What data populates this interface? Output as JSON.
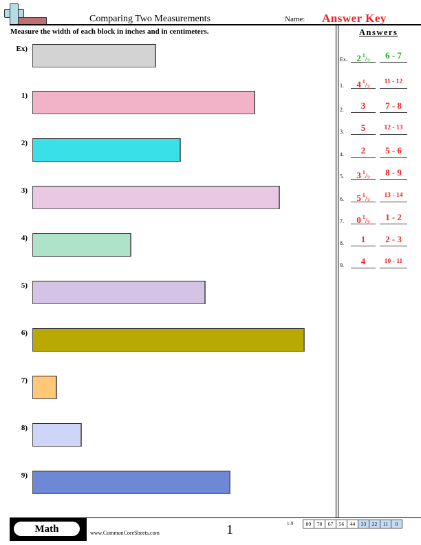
{
  "header": {
    "logo": "plus-ruler-logo",
    "title": "Comparing Two Measurements",
    "name_label": "Name:",
    "name_value": "Answer Key"
  },
  "instructions": "Measure the width of each block in inches and in centimeters.",
  "colors": {
    "answer_red": "#ee2222",
    "example_green": "#22aa22"
  },
  "problems": [
    {
      "label": "Ex)",
      "color": "#d3d3d3",
      "width_in": "2 1/2"
    },
    {
      "label": "1)",
      "color": "#f2b3c9",
      "width_in": "4 1/2"
    },
    {
      "label": "2)",
      "color": "#3ae0e8",
      "width_in": "3"
    },
    {
      "label": "3)",
      "color": "#e9c8e4",
      "width_in": "5"
    },
    {
      "label": "4)",
      "color": "#aee3c9",
      "width_in": "2"
    },
    {
      "label": "5)",
      "color": "#d4c3e4",
      "width_in": "3 1/2"
    },
    {
      "label": "6)",
      "color": "#bba903",
      "width_in": "5 1/2"
    },
    {
      "label": "7)",
      "color": "#ffc879",
      "width_in": "0 1/2"
    },
    {
      "label": "8)",
      "color": "#cdd5f8",
      "width_in": "1"
    },
    {
      "label": "9)",
      "color": "#6d89d6",
      "width_in": "4"
    }
  ],
  "answers": {
    "heading": "Answers",
    "rows": [
      {
        "num": "Ex.",
        "whole": "2",
        "frac": true,
        "cm": "6 - 7",
        "green": true
      },
      {
        "num": "1.",
        "whole": "4",
        "frac": true,
        "cm": "11 - 12",
        "green": false
      },
      {
        "num": "2.",
        "whole": "3",
        "frac": false,
        "cm": "7 - 8",
        "green": false
      },
      {
        "num": "3.",
        "whole": "5",
        "frac": false,
        "cm": "12 - 13",
        "green": false
      },
      {
        "num": "4.",
        "whole": "2",
        "frac": false,
        "cm": "5 - 6",
        "green": false
      },
      {
        "num": "5.",
        "whole": "3",
        "frac": true,
        "cm": "8 - 9",
        "green": false
      },
      {
        "num": "6.",
        "whole": "5",
        "frac": true,
        "cm": "13 - 14",
        "green": false
      },
      {
        "num": "7.",
        "whole": "0",
        "frac": true,
        "cm": "1 - 2",
        "green": false
      },
      {
        "num": "8.",
        "whole": "1",
        "frac": false,
        "cm": "2 - 3",
        "green": false
      },
      {
        "num": "9.",
        "whole": "4",
        "frac": false,
        "cm": "10 - 11",
        "green": false
      }
    ],
    "frac_num": "1",
    "frac_den": "2"
  },
  "footer": {
    "subject": "Math",
    "url": "www.CommonCoreSheets.com",
    "page": "1",
    "score_label": "1-9",
    "scores": [
      "89",
      "78",
      "67",
      "56",
      "44",
      "33",
      "22",
      "11",
      "0"
    ],
    "score_highlight_from": 5,
    "score_highlight_color": "#c6dcf5"
  }
}
